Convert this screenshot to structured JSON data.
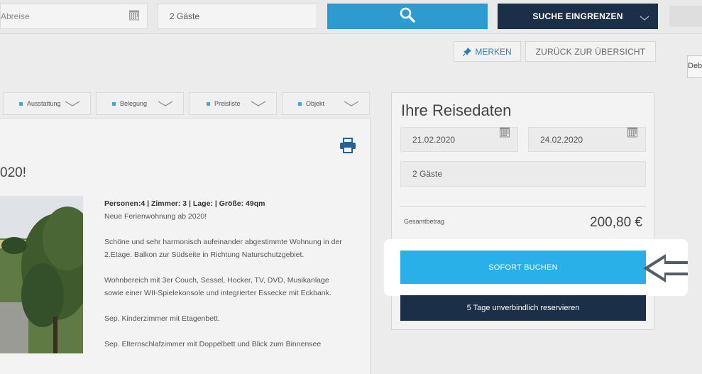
{
  "search": {
    "departure_placeholder": "Abreise",
    "guests_value": "2 Gäste",
    "filter_label": "SUCHE EINGRENZEN"
  },
  "actions": {
    "save_label": "MERKEN",
    "back_label": "ZURÜCK ZUR ÜBERSICHT",
    "side_tab_label": "Deb"
  },
  "tabs": [
    {
      "label": "Ausstattung"
    },
    {
      "label": "Belegung"
    },
    {
      "label": "Preisliste"
    },
    {
      "label": "Objekt"
    }
  ],
  "description": {
    "heading": "020!",
    "facts": "Personen:4 | Zimmer: 3 | Lage: | Größe: 49qm",
    "line1": "Neue Ferienwohnung ab 2020!",
    "para2": "Schöne und sehr harmonisch aufeinander abgestimmte Wohnung in der 2.Etage. Balkon zur Südseite in Richtung Naturschutzgebiet.",
    "para3": "Wohnbereich mit 3er Couch, Sessel, Hocker, TV, DVD, Musikanlage sowie einer WII-Spielekonsole und integrierter Essecke mit Eckbank.",
    "para4": "Sep. Kinderzimmer mit Etagenbett.",
    "para5": "Sep. Elternschlafzimmer mit Doppelbett und Blick zum Binnensee"
  },
  "booking": {
    "title": "Ihre Reisedaten",
    "arrival": "21.02.2020",
    "departure": "24.02.2020",
    "guests": "2 Gäste",
    "total_label": "Gesamtbetrag",
    "total_value": "200,80 €",
    "book_label": "SOFORT BUCHEN",
    "reserve_label": "5 Tage unverbindlich reservieren"
  },
  "colors": {
    "primary_blue": "#2ab0e8",
    "search_blue": "#2e9bd0",
    "navy": "#1c2f48"
  }
}
